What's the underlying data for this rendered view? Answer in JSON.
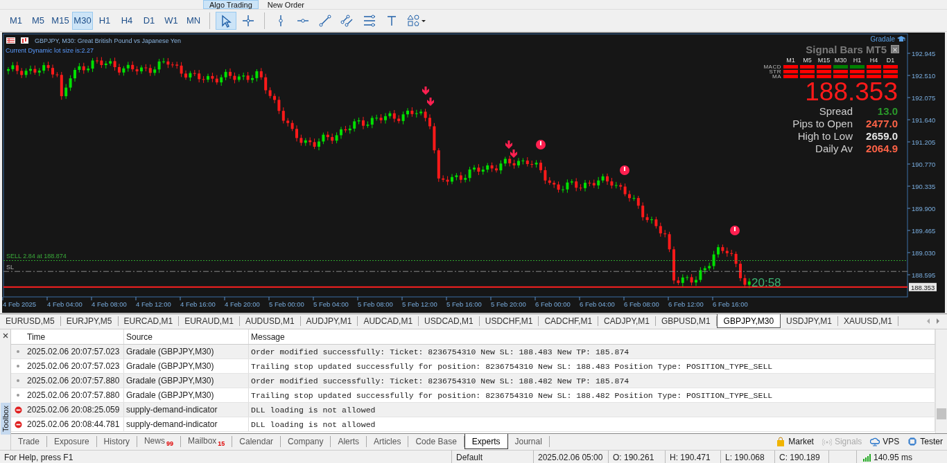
{
  "toolbar_top": {
    "buttons": [
      {
        "label": "Algo Trading",
        "selected": true
      },
      {
        "label": "New Order",
        "selected": false
      }
    ]
  },
  "timeframes": [
    {
      "label": "M1",
      "selected": false
    },
    {
      "label": "M5",
      "selected": false
    },
    {
      "label": "M15",
      "selected": false
    },
    {
      "label": "M30",
      "selected": true
    },
    {
      "label": "H1",
      "selected": false
    },
    {
      "label": "H4",
      "selected": false
    },
    {
      "label": "D1",
      "selected": false
    },
    {
      "label": "W1",
      "selected": false
    },
    {
      "label": "MN",
      "selected": false
    }
  ],
  "tools": [
    {
      "kind": "cursor",
      "selected": true
    },
    {
      "kind": "crosshair",
      "selected": false
    },
    {
      "kind": "vline",
      "selected": false
    },
    {
      "kind": "hline",
      "selected": false
    },
    {
      "kind": "trend",
      "selected": false
    },
    {
      "kind": "channel",
      "selected": false
    },
    {
      "kind": "fibo",
      "selected": false
    },
    {
      "kind": "text",
      "selected": false
    },
    {
      "kind": "shapes",
      "selected": false
    }
  ],
  "chart": {
    "title": "GBPJPY, M30: Great British Pound vs Japanese Yen",
    "lot_text": "Current Dynamic lot size is:2.27",
    "sell_line": "SELL 2.84 at 188.874",
    "sl_line": "SL",
    "countdown": "20:58",
    "current_price": "188.353",
    "price_axis": [
      "192.945",
      "192.510",
      "192.075",
      "191.640",
      "191.205",
      "190.770",
      "190.335",
      "189.900",
      "189.465",
      "189.030",
      "188.595"
    ],
    "time_axis": [
      "4 Feb 2025",
      "4 Feb 04:00",
      "4 Feb 08:00",
      "4 Feb 12:00",
      "4 Feb 16:00",
      "4 Feb 20:00",
      "5 Feb 00:00",
      "5 Feb 04:00",
      "5 Feb 08:00",
      "5 Feb 12:00",
      "5 Feb 16:00",
      "5 Feb 20:00",
      "6 Feb 00:00",
      "6 Feb 04:00",
      "6 Feb 08:00",
      "6 Feb 12:00",
      "6 Feb 16:00"
    ]
  },
  "signal_panel": {
    "brand": "Gradale",
    "title": "Signal Bars MT5",
    "timeframes": [
      "M1",
      "M5",
      "M15",
      "M30",
      "H1",
      "H4",
      "D1"
    ],
    "rows": [
      {
        "label": "MACD",
        "cells": [
          {
            "color": "#ff0000"
          },
          {
            "color": "#ff0000"
          },
          {
            "color": "#ff0000"
          },
          {
            "color": "#008000"
          },
          {
            "color": "#008000"
          },
          {
            "color": "#ff0000"
          },
          {
            "color": "#ff0000"
          }
        ]
      },
      {
        "label": "STR",
        "cells": [
          {
            "color": "#ff0000"
          },
          {
            "color": "#ff0000"
          },
          {
            "color": "#ff0000"
          },
          {
            "color": "#ff0000"
          },
          {
            "color": "#ff0000"
          },
          {
            "color": "#ff0000"
          },
          {
            "color": "#ff0000"
          }
        ]
      },
      {
        "label": "MA",
        "cells": [
          {
            "color": "#ff0000"
          },
          {
            "color": "#ff0000"
          },
          {
            "color": "#ff0000"
          },
          {
            "color": "#ff0000"
          },
          {
            "color": "#ff0000"
          },
          {
            "color": "#ff0000"
          },
          {
            "color": "#ff0000"
          }
        ]
      }
    ],
    "price": "188.353",
    "stats": [
      {
        "label": "Spread",
        "value": "13.0",
        "color": "#2a9a2a"
      },
      {
        "label": "Pips to Open",
        "value": "2477.0",
        "color": "#ff6347"
      },
      {
        "label": "High to Low",
        "value": "2659.0",
        "color": "#e6e6e6"
      },
      {
        "label": "Daily Av",
        "value": "2064.9",
        "color": "#ff6347"
      }
    ]
  },
  "symbol_tabs": [
    {
      "label": "EURUSD,M5",
      "selected": false
    },
    {
      "label": "EURJPY,M5",
      "selected": false
    },
    {
      "label": "EURCAD,M1",
      "selected": false
    },
    {
      "label": "EURAUD,M1",
      "selected": false
    },
    {
      "label": "AUDUSD,M1",
      "selected": false
    },
    {
      "label": "AUDJPY,M1",
      "selected": false
    },
    {
      "label": "AUDCAD,M1",
      "selected": false
    },
    {
      "label": "USDCAD,M1",
      "selected": false
    },
    {
      "label": "USDCHF,M1",
      "selected": false
    },
    {
      "label": "CADCHF,M1",
      "selected": false
    },
    {
      "label": "CADJPY,M1",
      "selected": false
    },
    {
      "label": "GBPUSD,M1",
      "selected": false
    },
    {
      "label": "GBPJPY,M30",
      "selected": true
    },
    {
      "label": "USDJPY,M1",
      "selected": false
    },
    {
      "label": "XAUUSD,M1",
      "selected": false
    }
  ],
  "toolbox": {
    "title": "Toolbox",
    "columns": [
      "Time",
      "Source",
      "Message"
    ],
    "rows": [
      {
        "kind": "info",
        "time": "2025.02.06 20:07:57.023",
        "source": "Gradale (GBPJPY,M30)",
        "message": "Order modified successfully: Ticket: 8236754310 New SL: 188.483 New TP: 185.874"
      },
      {
        "kind": "info",
        "time": "2025.02.06 20:07:57.023",
        "source": "Gradale (GBPJPY,M30)",
        "message": "Trailing stop updated successfully for position: 8236754310 New SL: 188.483 Position Type: POSITION_TYPE_SELL"
      },
      {
        "kind": "info",
        "time": "2025.02.06 20:07:57.880",
        "source": "Gradale (GBPJPY,M30)",
        "message": "Order modified successfully: Ticket: 8236754310 New SL: 188.482 New TP: 185.874"
      },
      {
        "kind": "info",
        "time": "2025.02.06 20:07:57.880",
        "source": "Gradale (GBPJPY,M30)",
        "message": "Trailing stop updated successfully for position: 8236754310 New SL: 188.482 Position Type: POSITION_TYPE_SELL"
      },
      {
        "kind": "error",
        "time": "2025.02.06 20:08:25.059",
        "source": "supply-demand-indicator",
        "message": "DLL loading is not allowed"
      },
      {
        "kind": "error",
        "time": "2025.02.06 20:08:44.781",
        "source": "supply-demand-indicator",
        "message": "DLL loading is not allowed"
      }
    ]
  },
  "bottom_tabs": [
    {
      "label": "Trade",
      "selected": false
    },
    {
      "label": "Exposure",
      "selected": false
    },
    {
      "label": "History",
      "selected": false
    },
    {
      "label": "News",
      "badge": "99",
      "selected": false
    },
    {
      "label": "Mailbox",
      "badge": "15",
      "selected": false
    },
    {
      "label": "Calendar",
      "selected": false
    },
    {
      "label": "Company",
      "selected": false
    },
    {
      "label": "Alerts",
      "selected": false
    },
    {
      "label": "Articles",
      "selected": false
    },
    {
      "label": "Code Base",
      "selected": false
    },
    {
      "label": "Experts",
      "selected": true
    },
    {
      "label": "Journal",
      "selected": false
    }
  ],
  "services": [
    {
      "kind": "market",
      "label": "Market",
      "disabled": false
    },
    {
      "kind": "signals",
      "label": "Signals",
      "disabled": true
    },
    {
      "kind": "vps",
      "label": "VPS",
      "disabled": false
    },
    {
      "kind": "tester",
      "label": "Tester",
      "disabled": false
    }
  ],
  "status_bar": {
    "help": "For Help, press F1",
    "profile": "Default",
    "datetime": "2025.02.06 05:00",
    "open": "O: 190.261",
    "high": "H: 190.471",
    "low": "L: 190.068",
    "close": "C: 190.189",
    "ping": "140.95 ms"
  }
}
